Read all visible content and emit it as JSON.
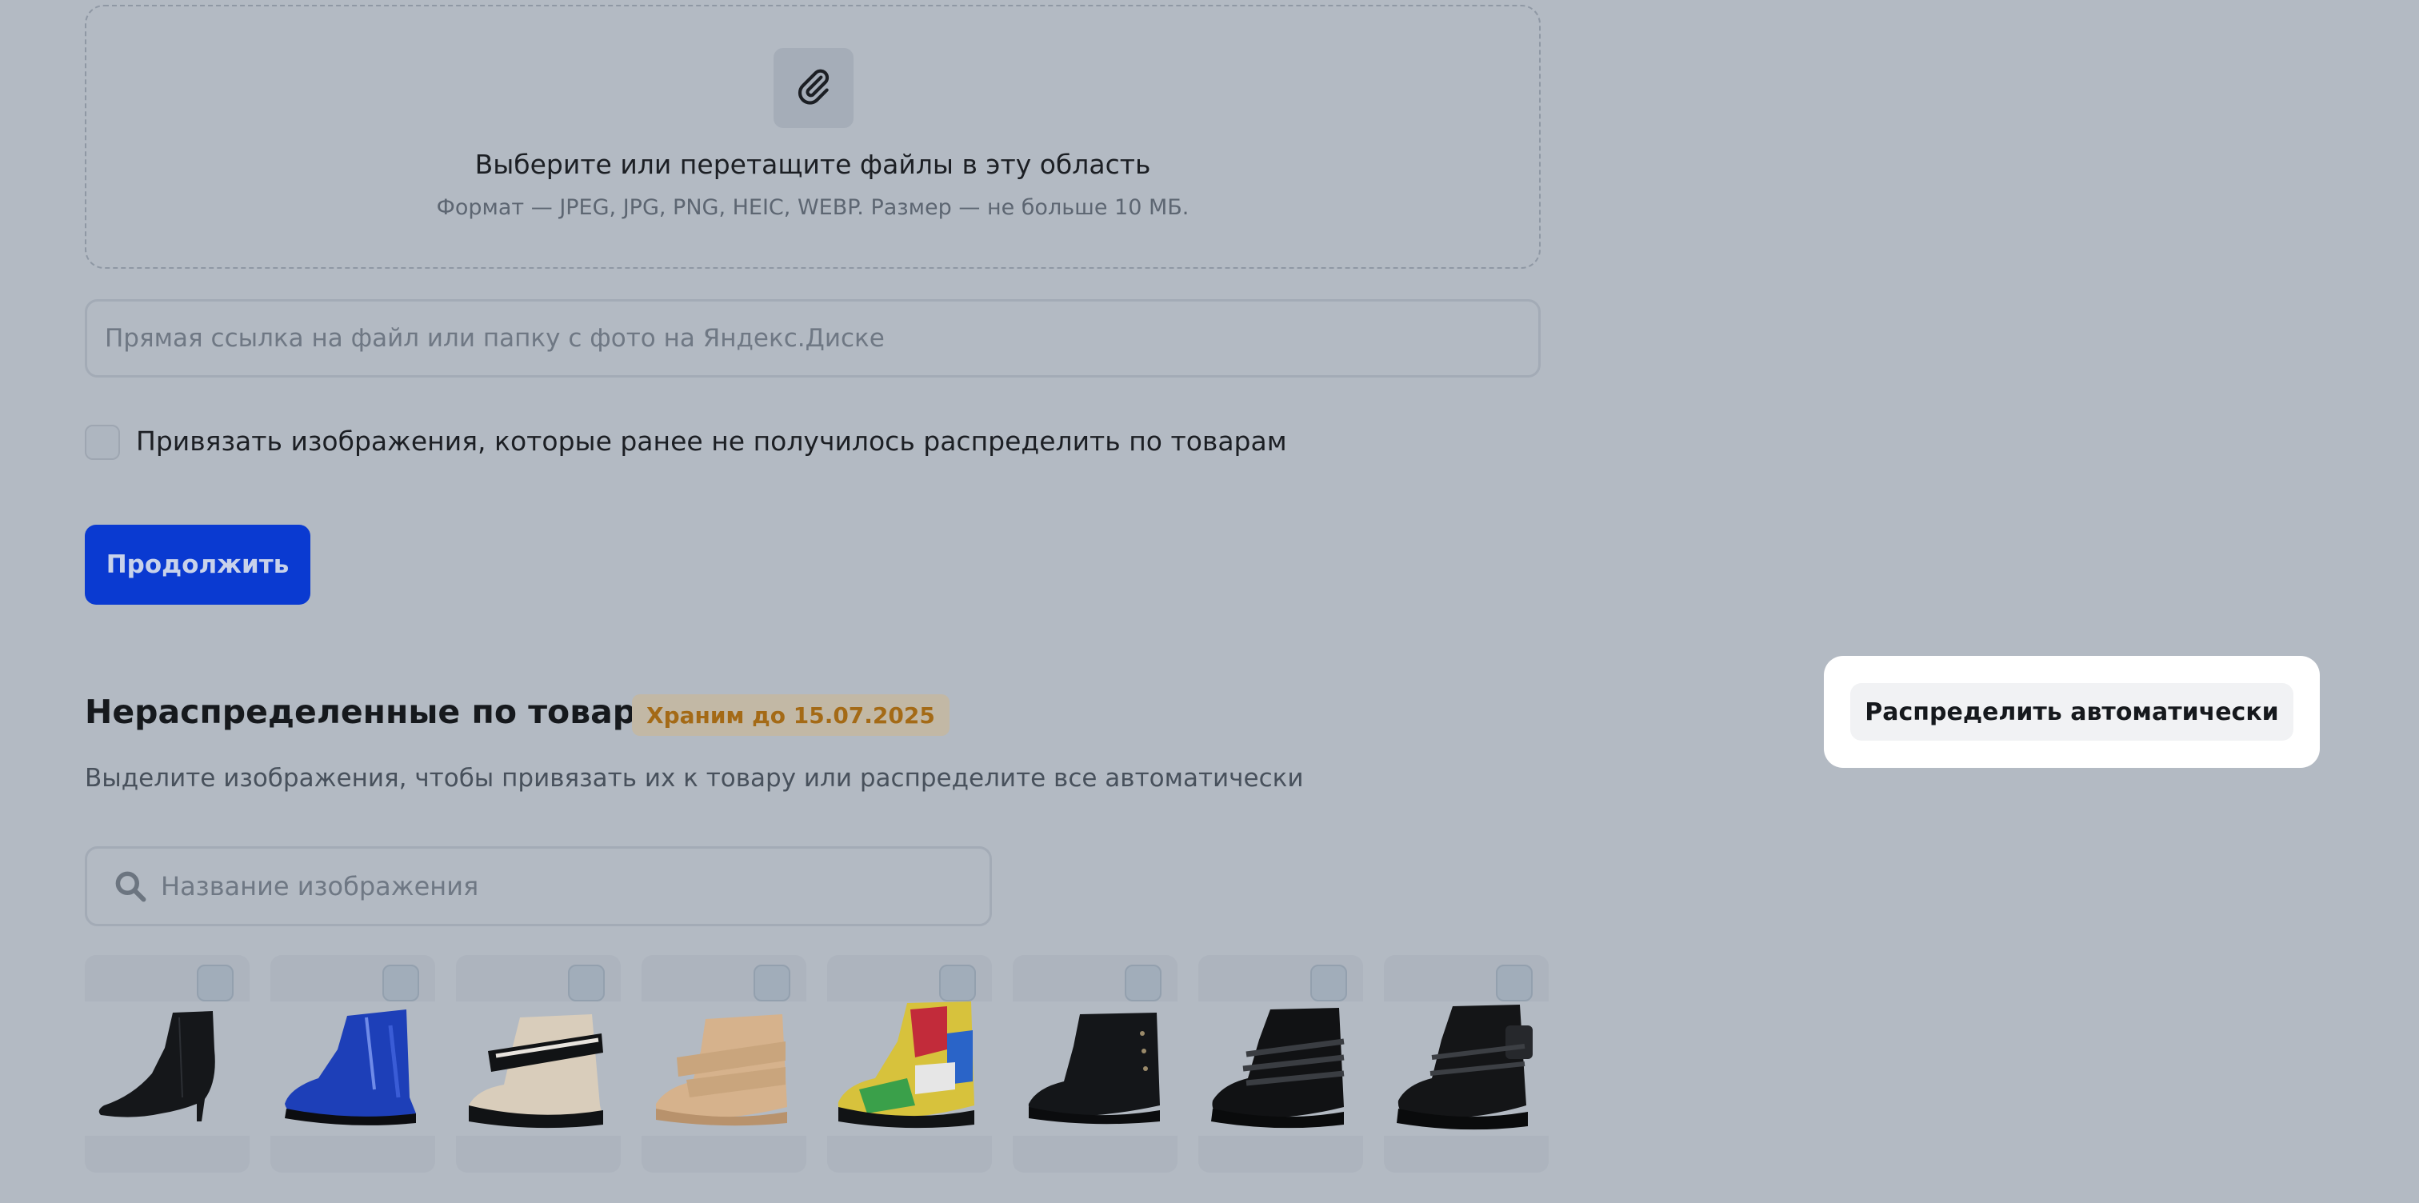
{
  "dropzone": {
    "icon": "paperclip-icon",
    "title": "Выберите или перетащите файлы в эту область",
    "hint": "Формат — JPEG, JPG, PNG, HEIC, WEBP. Размер — не больше 10 МБ."
  },
  "link_input": {
    "placeholder": "Прямая ссылка на файл или папку с фото на Яндекс.Диске",
    "value": ""
  },
  "bind_checkbox": {
    "label": "Привязать изображения, которые ранее не получилось распределить по товарам",
    "checked": false
  },
  "continue_button": {
    "label": "Продолжить",
    "color": "#0a3ad1"
  },
  "unassigned": {
    "title": "Нераспределенные по товарам",
    "badge": "Храним до 15.07.2025",
    "subtitle": "Выделите изображения, чтобы привязать их к товару или распределите все автоматически",
    "auto_button": "Распределить автоматически",
    "search": {
      "placeholder": "Название изображения",
      "value": "",
      "icon": "search-icon"
    },
    "images": [
      {
        "depicts": "black heeled ankle boot",
        "selected": false
      },
      {
        "depicts": "blue patent boot",
        "selected": false
      },
      {
        "depicts": "beige and black boot with straps",
        "selected": false
      },
      {
        "depicts": "golden boot with straps",
        "selected": false
      },
      {
        "depicts": "colorful print boot",
        "selected": false
      },
      {
        "depicts": "black leather ankle boot",
        "selected": false
      },
      {
        "depicts": "black patent boot with straps",
        "selected": false
      },
      {
        "depicts": "black chunky boot with pouch",
        "selected": false
      }
    ]
  },
  "colors": {
    "background": "#b3bac3",
    "primary": "#0a3ad1",
    "badge_text": "#a46a16"
  }
}
